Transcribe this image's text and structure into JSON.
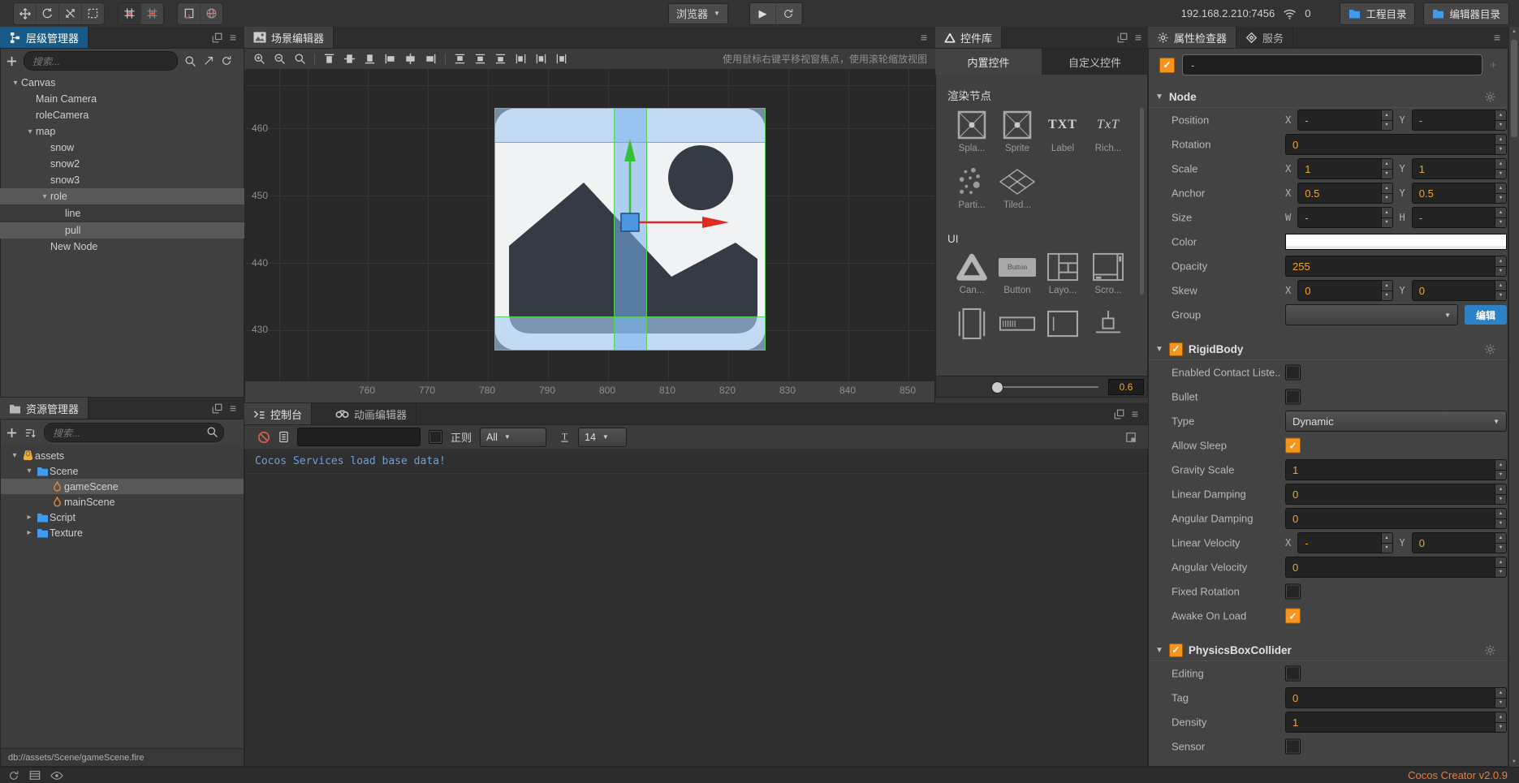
{
  "colors": {
    "accent_orange": "#f5a623",
    "tab_blue": "#175a88",
    "log_blue": "#6c9fd8",
    "button_blue": "#2c82c9",
    "folder_blue": "#3f9bf0",
    "version_orange": "#f07b35"
  },
  "toolbar": {
    "tool_icons": [
      "move",
      "rotate",
      "scale",
      "recttool"
    ],
    "pivot_icons": [
      "pivot1",
      "pivot2"
    ],
    "view_icons": [
      "cornertool",
      "globetool"
    ],
    "browser_label": "浏览器",
    "ip": "192.168.2.210:7456",
    "connections": "0",
    "project_dir_label": "工程目录",
    "editor_dir_label": "编辑器目录"
  },
  "hierarchy": {
    "title": "层级管理器",
    "search_placeholder": "搜索...",
    "search_icons": [
      "magnifier",
      "diagarrow",
      "refresh"
    ],
    "tree": [
      {
        "label": "Canvas",
        "depth": 0,
        "caret": "open"
      },
      {
        "label": "Main Camera",
        "depth": 1
      },
      {
        "label": "roleCamera",
        "depth": 1
      },
      {
        "label": "map",
        "depth": 1,
        "caret": "open"
      },
      {
        "label": "snow",
        "depth": 2
      },
      {
        "label": "snow2",
        "depth": 2
      },
      {
        "label": "snow3",
        "depth": 2
      },
      {
        "label": "role",
        "depth": 2,
        "caret": "open",
        "selected": true
      },
      {
        "label": "line",
        "depth": 3,
        "dim": true
      },
      {
        "label": "pull",
        "depth": 3,
        "selected": true
      },
      {
        "label": "New Node",
        "depth": 2
      }
    ]
  },
  "assets": {
    "title": "资源管理器",
    "search_placeholder": "搜索...",
    "status_path": "db://assets/Scene/gameScene.fire",
    "tree": [
      {
        "label": "assets",
        "depth": 0,
        "caret": "open",
        "icon": "assetsroot"
      },
      {
        "label": "Scene",
        "depth": 1,
        "caret": "open",
        "icon": "folder"
      },
      {
        "label": "gameScene",
        "depth": 2,
        "icon": "scenefile",
        "selected": true
      },
      {
        "label": "mainScene",
        "depth": 2,
        "icon": "scenefile"
      },
      {
        "label": "Script",
        "depth": 1,
        "caret": "closed",
        "icon": "folder"
      },
      {
        "label": "Texture",
        "depth": 1,
        "caret": "closed",
        "icon": "folder"
      }
    ]
  },
  "scene": {
    "tab": "场景编辑器",
    "hint": "使用鼠标右键平移视窗焦点，使用滚轮缩放视图",
    "toolbar_icons": [
      "magplus",
      "magminus",
      "magnifier",
      "sep",
      "altop",
      "almid",
      "albot",
      "alleft",
      "alcen",
      "alright",
      "sep",
      "dtop",
      "dmid",
      "dbot",
      "dleft",
      "dcen",
      "dright"
    ],
    "y_ticks": [
      460,
      450,
      440,
      430
    ],
    "x_ticks": [
      760,
      770,
      780,
      790,
      800,
      810,
      820,
      830,
      840,
      850
    ]
  },
  "console": {
    "tab": "控制台",
    "anim_tab": "动画编辑器",
    "regex_label": "正则",
    "filter_value": "All",
    "fontsize_value": "14",
    "log": "Cocos Services load base data!"
  },
  "library": {
    "tab": "控件库",
    "subtabs": [
      "内置控件",
      "自定义控件"
    ],
    "zoom_value": "0.6",
    "sections": [
      {
        "title": "渲染节点",
        "items": [
          {
            "label": "Spla...",
            "icon": "sprite"
          },
          {
            "label": "Sprite",
            "icon": "sprite"
          },
          {
            "label": "Label",
            "icon": "labeltxt",
            "icon_text": "TXT"
          },
          {
            "label": "Rich...",
            "icon": "richtxt",
            "icon_text": "TxT"
          },
          {
            "label": "Parti...",
            "icon": "particle"
          },
          {
            "label": "Tiled...",
            "icon": "tiledmap"
          }
        ]
      },
      {
        "title": "UI",
        "items": [
          {
            "label": "Can...",
            "icon": "canvastri"
          },
          {
            "label": "Button",
            "icon": "buttonw",
            "icon_text": "Button"
          },
          {
            "label": "Layo...",
            "icon": "layout"
          },
          {
            "label": "Scro...",
            "icon": "scrollview"
          }
        ]
      }
    ],
    "partial_icons": [
      "pageview",
      "progressbar",
      "editbox",
      "sliderw"
    ]
  },
  "inspector": {
    "tab": "属性检查器",
    "services_tab": "服务",
    "name_value": "-",
    "sections": [
      {
        "title": "Node",
        "rows": [
          {
            "label": "Position",
            "control": "xy",
            "ax": [
              "X",
              "Y"
            ],
            "values": [
              "-",
              "-"
            ]
          },
          {
            "label": "Rotation",
            "control": "num",
            "value": "0"
          },
          {
            "label": "Scale",
            "control": "xy",
            "ax": [
              "X",
              "Y"
            ],
            "values": [
              "1",
              "1"
            ]
          },
          {
            "label": "Anchor",
            "control": "xy",
            "ax": [
              "X",
              "Y"
            ],
            "values": [
              "0.5",
              "0.5"
            ]
          },
          {
            "label": "Size",
            "control": "xy",
            "ax": [
              "W",
              "H"
            ],
            "values": [
              "-",
              "-"
            ]
          },
          {
            "label": "Color",
            "control": "color",
            "value": "#ffffff"
          },
          {
            "label": "Opacity",
            "control": "num",
            "value": "255"
          },
          {
            "label": "Skew",
            "control": "xy",
            "ax": [
              "X",
              "Y"
            ],
            "values": [
              "0",
              "0"
            ]
          },
          {
            "label": "Group",
            "control": "group",
            "value": "",
            "edit_label": "编辑"
          }
        ]
      },
      {
        "title": "RigidBody",
        "checked": true,
        "rows": [
          {
            "label": "Enabled Contact Liste...",
            "control": "checkbox",
            "checked": false
          },
          {
            "label": "Bullet",
            "control": "checkbox",
            "checked": false
          },
          {
            "label": "Type",
            "control": "select",
            "value": "Dynamic"
          },
          {
            "label": "Allow Sleep",
            "control": "checkbox",
            "checked": true
          },
          {
            "label": "Gravity Scale",
            "control": "num",
            "value": "1"
          },
          {
            "label": "Linear Damping",
            "control": "num",
            "value": "0"
          },
          {
            "label": "Angular Damping",
            "control": "num",
            "value": "0"
          },
          {
            "label": "Linear Velocity",
            "control": "xy",
            "ax": [
              "X",
              "Y"
            ],
            "values": [
              "-",
              "0"
            ]
          },
          {
            "label": "Angular Velocity",
            "control": "num",
            "value": "0"
          },
          {
            "label": "Fixed Rotation",
            "control": "checkbox",
            "checked": false
          },
          {
            "label": "Awake On Load",
            "control": "checkbox",
            "checked": true
          }
        ]
      },
      {
        "title": "PhysicsBoxCollider",
        "checked": true,
        "rows": [
          {
            "label": "Editing",
            "control": "checkbox",
            "checked": false
          },
          {
            "label": "Tag",
            "control": "num",
            "value": "0"
          },
          {
            "label": "Density",
            "control": "num",
            "value": "1"
          },
          {
            "label": "Sensor",
            "control": "checkbox",
            "checked": false
          }
        ]
      }
    ]
  },
  "statusbar": {
    "icons": [
      "sync",
      "list",
      "eye"
    ],
    "version": "Cocos Creator v2.0.9"
  }
}
